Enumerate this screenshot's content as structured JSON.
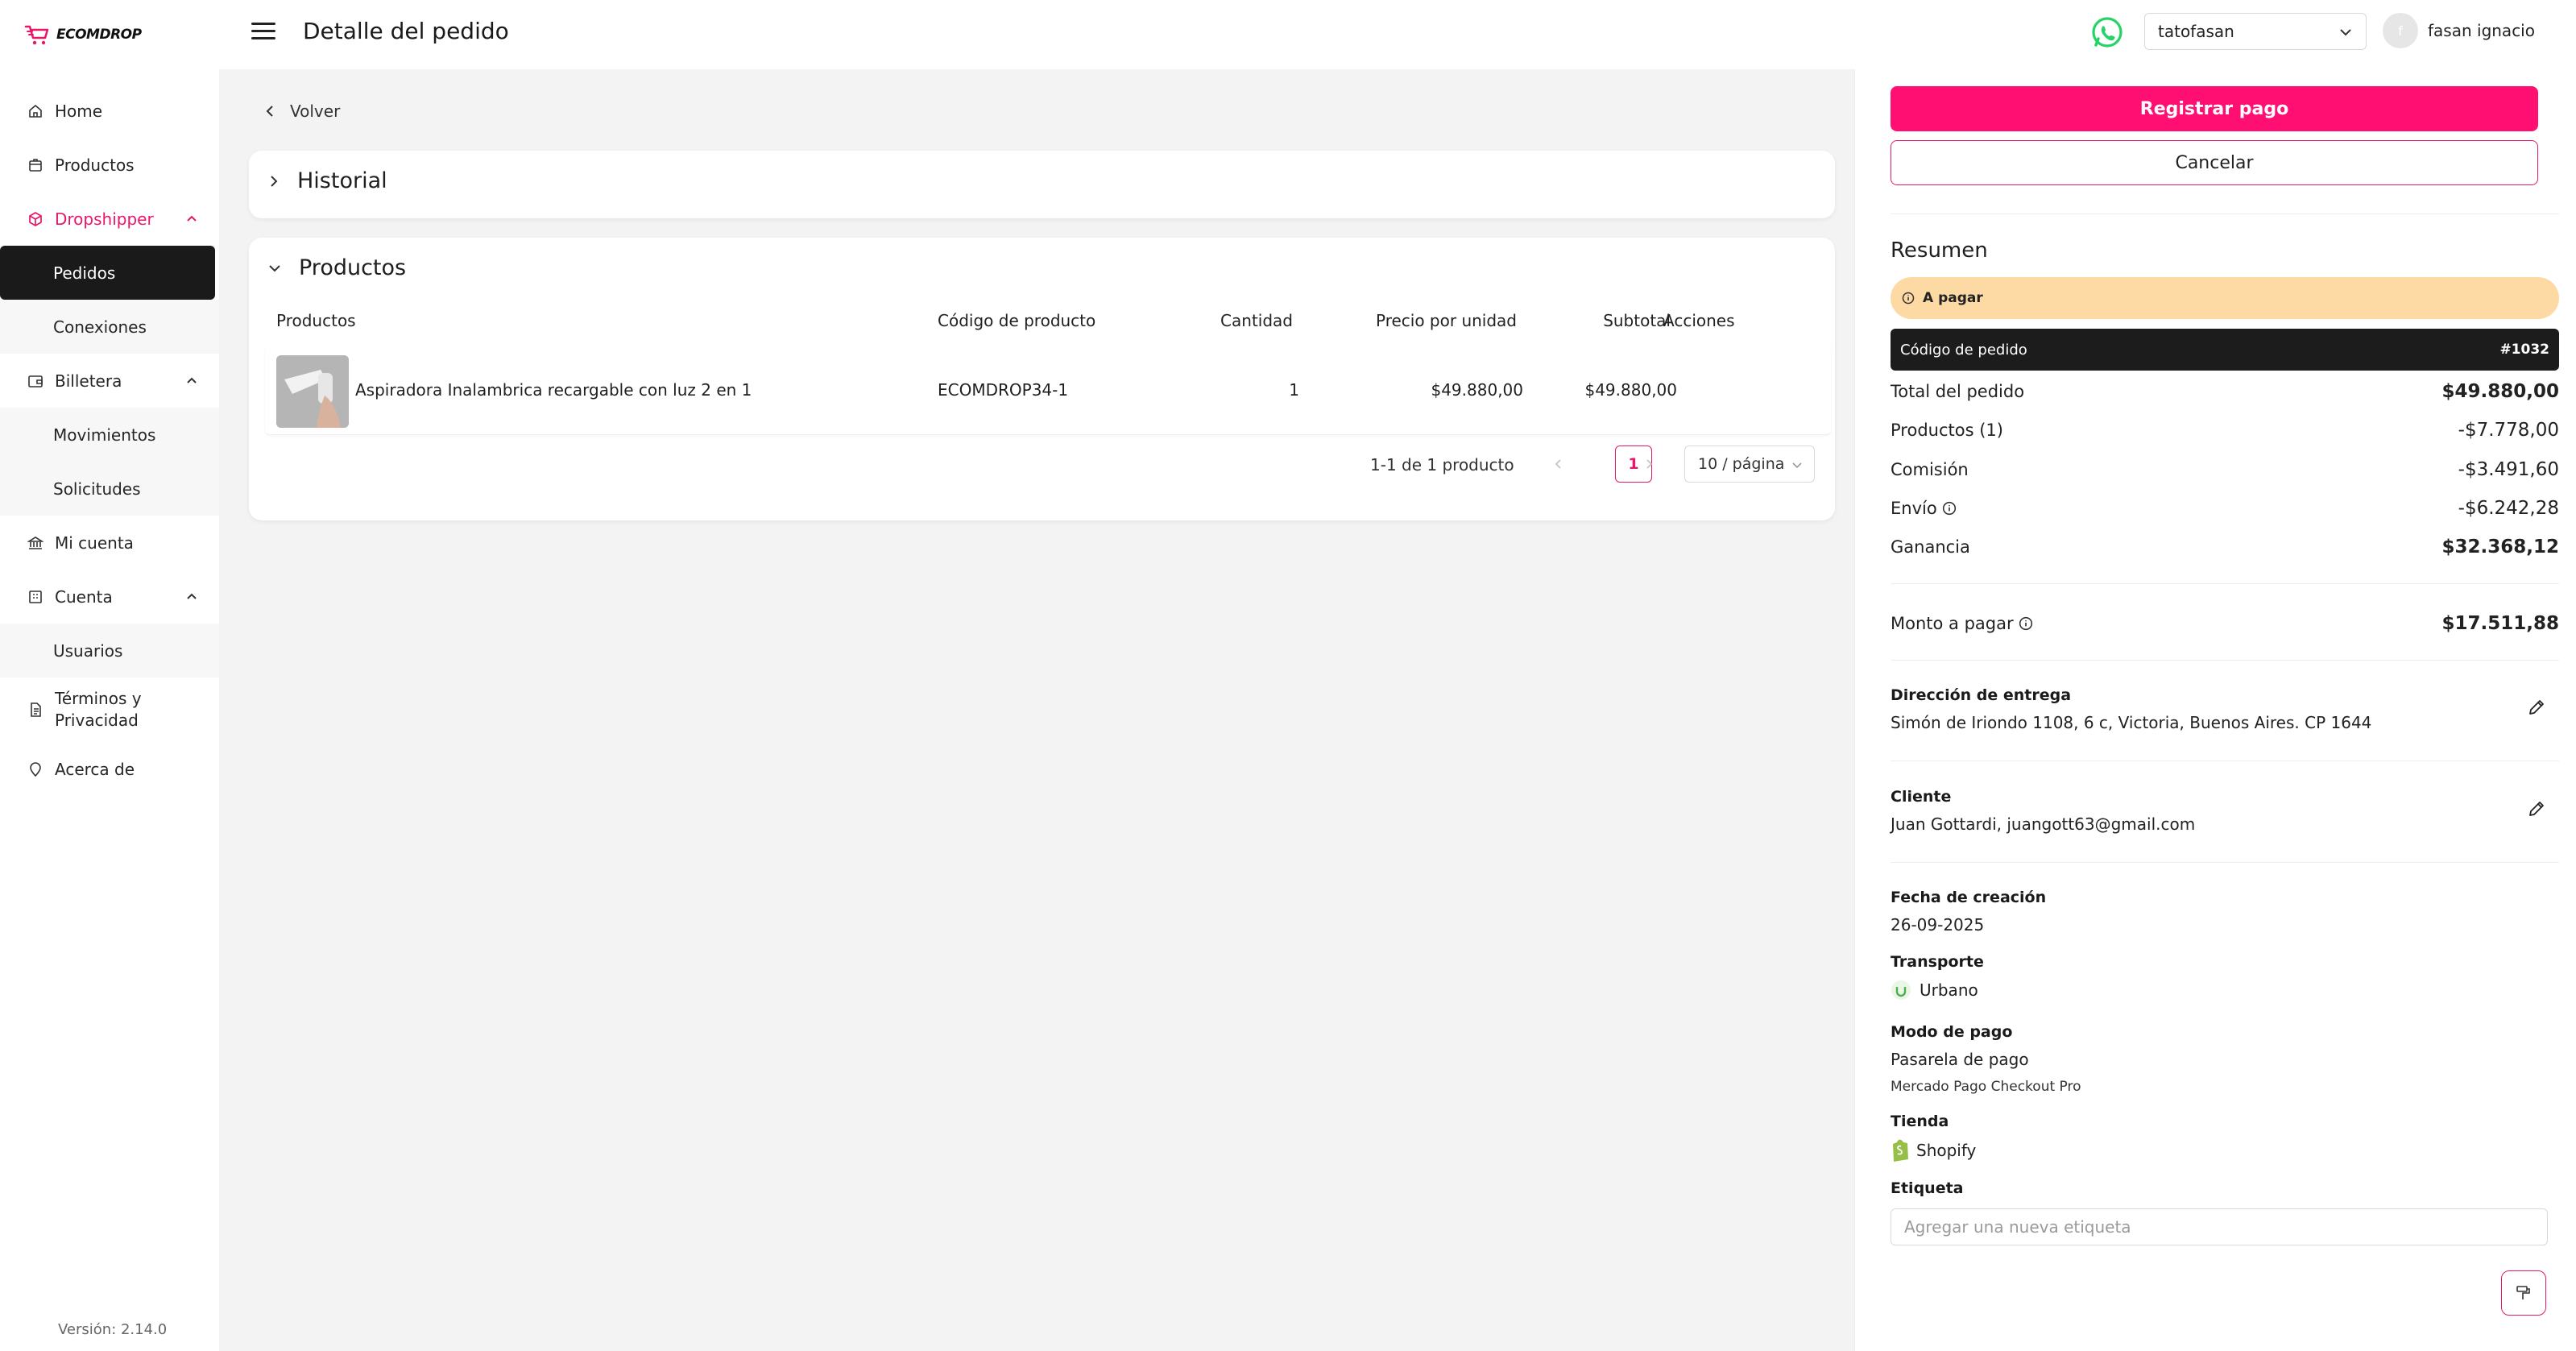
{
  "brand": {
    "name": "ECOMDROP",
    "accent": "#e8176a",
    "primary_button": "#ff0f72"
  },
  "sidebar": {
    "items": [
      {
        "label": "Home",
        "icon": "home-icon"
      },
      {
        "label": "Productos",
        "icon": "box-icon"
      },
      {
        "label": "Dropshipper",
        "icon": "cube-icon",
        "expanded": true
      },
      {
        "label": "Pedidos",
        "selected": true
      },
      {
        "label": "Conexiones"
      },
      {
        "label": "Billetera",
        "icon": "wallet-icon",
        "expanded": true
      },
      {
        "label": "Movimientos"
      },
      {
        "label": "Solicitudes"
      },
      {
        "label": "Mi cuenta",
        "icon": "bank-icon"
      },
      {
        "label": "Cuenta",
        "icon": "building-icon",
        "expanded": true
      },
      {
        "label": "Usuarios"
      },
      {
        "label": "Términos y Privacidad",
        "icon": "document-icon"
      },
      {
        "label": "Acerca de",
        "icon": "location-icon"
      }
    ],
    "version": "Versión: 2.14.0"
  },
  "header": {
    "title": "Detalle del pedido",
    "store_select": "tatofasan",
    "user_initial": "f",
    "user_name": "fasan ignacio"
  },
  "main": {
    "back_label": "Volver",
    "historial_title": "Historial",
    "productos_title": "Productos",
    "table": {
      "columns": [
        "Productos",
        "Código de producto",
        "Cantidad",
        "Precio por unidad",
        "Subtotal",
        "Acciones"
      ],
      "rows": [
        {
          "name": "Aspiradora Inalambrica recargable con luz 2 en 1",
          "code": "ECOMDROP34-1",
          "qty": "1",
          "unit_price": "$49.880,00",
          "subtotal": "$49.880,00"
        }
      ]
    },
    "pagination": {
      "info": "1-1 de 1 producto",
      "current_page": "1",
      "page_size": "10 / página"
    }
  },
  "panel": {
    "pay_button": "Registrar pago",
    "cancel_button": "Cancelar",
    "summary_title": "Resumen",
    "status": "A pagar",
    "order_code_label": "Código de pedido",
    "order_code": "#1032",
    "summary_rows": [
      {
        "label": "Total del pedido",
        "value": "$49.880,00"
      },
      {
        "label": "Productos (1)",
        "value": "-$7.778,00"
      },
      {
        "label": "Comisión",
        "value": "-$3.491,60"
      },
      {
        "label": "Envío",
        "value": "-$6.242,28"
      },
      {
        "label": "Ganancia",
        "value": "$32.368,12"
      }
    ],
    "amount_label": "Monto a pagar",
    "amount_value": "$17.511,88",
    "address_label": "Dirección de entrega",
    "address_value": "Simón de Iriondo 1108, 6 c, Victoria, Buenos Aires. CP 1644",
    "client_label": "Cliente",
    "client_value": "Juan Gottardi, juangott63@gmail.com",
    "created_label": "Fecha de creación",
    "created_value": "26-09-2025",
    "transport_label": "Transporte",
    "transport_value": "Urbano",
    "payment_label": "Modo de pago",
    "payment_value": "Pasarela de pago",
    "payment_detail": "Mercado Pago Checkout Pro",
    "store_label": "Tienda",
    "store_value": "Shopify",
    "tag_label": "Etiqueta",
    "tag_placeholder": "Agregar una nueva etiqueta"
  }
}
